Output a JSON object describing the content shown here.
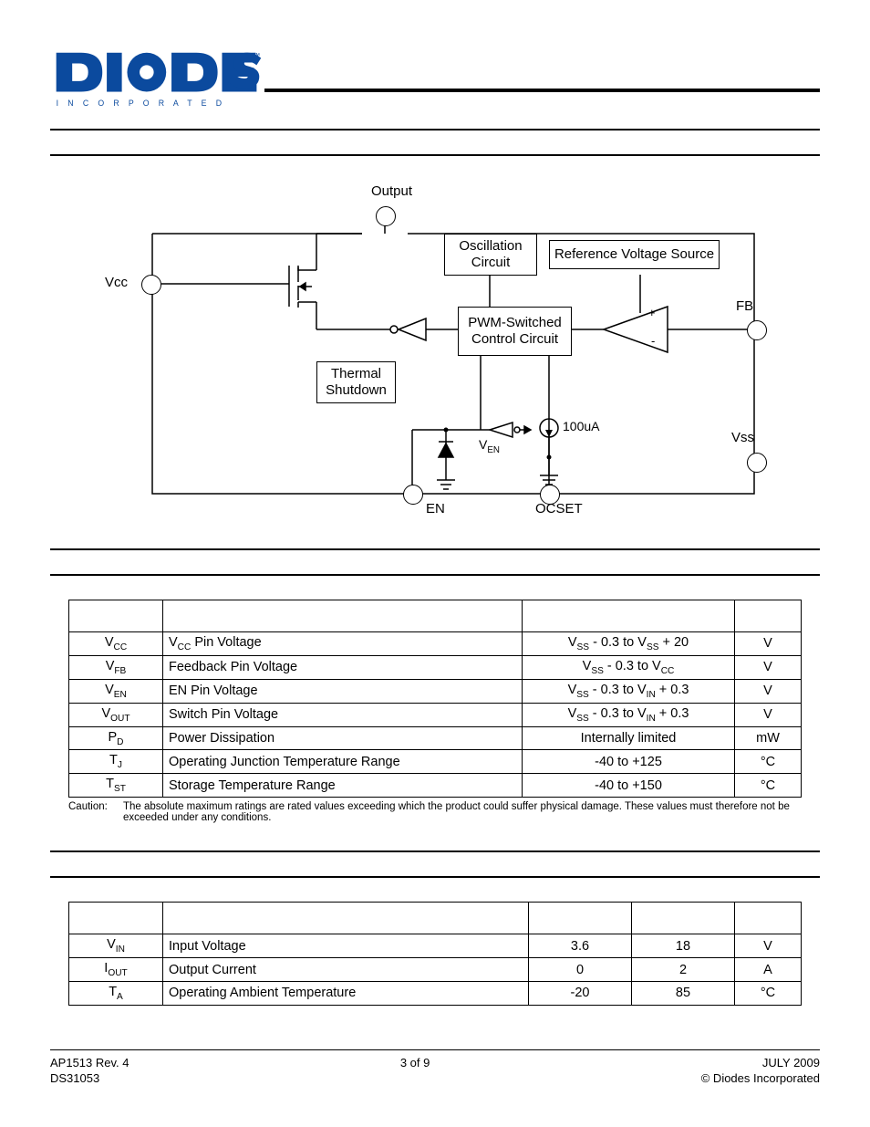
{
  "logo": {
    "brand": "DIODES",
    "tag": "I N C O R P O R A T E D"
  },
  "diagram": {
    "output": "Output",
    "vcc": "Vcc",
    "osc": "Oscillation\nCircuit",
    "ref": "Reference Voltage Source",
    "pwm": "PWM-Switched\nControl Circuit",
    "thermal": "Thermal\nShutdown",
    "ven_label": "V",
    "ven_sub": "EN",
    "i100": "100uA",
    "fb": "FB",
    "vss": "Vss",
    "en": "EN",
    "ocset": "OCSET",
    "plus": "+",
    "minus": "-"
  },
  "abs_rows": [
    {
      "sym": "V",
      "sub": "CC",
      "param": "V<sub>CC</sub> Pin Voltage",
      "rating": "V<sub>SS</sub> - 0.3 to V<sub>SS</sub> + 20",
      "unit": "V"
    },
    {
      "sym": "V",
      "sub": "FB",
      "param": "Feedback Pin Voltage",
      "rating": "V<sub>SS</sub> - 0.3 to V<sub>CC</sub>",
      "unit": "V"
    },
    {
      "sym": "V",
      "sub": "EN",
      "param": "EN Pin Voltage",
      "rating": "V<sub>SS</sub> - 0.3 to V<sub>IN</sub> + 0.3",
      "unit": "V"
    },
    {
      "sym": "V",
      "sub": "OUT",
      "param": "Switch Pin Voltage",
      "rating": "V<sub>SS</sub> - 0.3 to V<sub>IN</sub> + 0.3",
      "unit": "V"
    },
    {
      "sym": "P",
      "sub": "D",
      "param": "Power Dissipation",
      "rating": "Internally limited",
      "unit": "mW"
    },
    {
      "sym": "T",
      "sub": "J",
      "param": "Operating Junction Temperature Range",
      "rating": "-40 to +125",
      "unit": "°C"
    },
    {
      "sym": "T",
      "sub": "ST",
      "param": "Storage Temperature Range",
      "rating": "-40 to +150",
      "unit": "°C"
    }
  ],
  "caution": {
    "label": "Caution:",
    "text": "The absolute maximum ratings are rated values exceeding which the product could suffer physical damage. These values must therefore not be exceeded under any conditions."
  },
  "rec_rows": [
    {
      "sym": "V",
      "sub": "IN",
      "param": "Input Voltage",
      "min": "3.6",
      "max": "18",
      "unit": "V"
    },
    {
      "sym": "I",
      "sub": "OUT",
      "param": "Output Current",
      "min": "0",
      "max": "2",
      "unit": "A"
    },
    {
      "sym": "T",
      "sub": "A",
      "param": "Operating Ambient Temperature",
      "min": "-20",
      "max": "85",
      "unit": "°C"
    }
  ],
  "footer": {
    "left1": "AP1513 Rev. 4",
    "left2": "DS31053",
    "center": "3 of 9",
    "right1": "JULY 2009",
    "right2": "© Diodes Incorporated"
  }
}
